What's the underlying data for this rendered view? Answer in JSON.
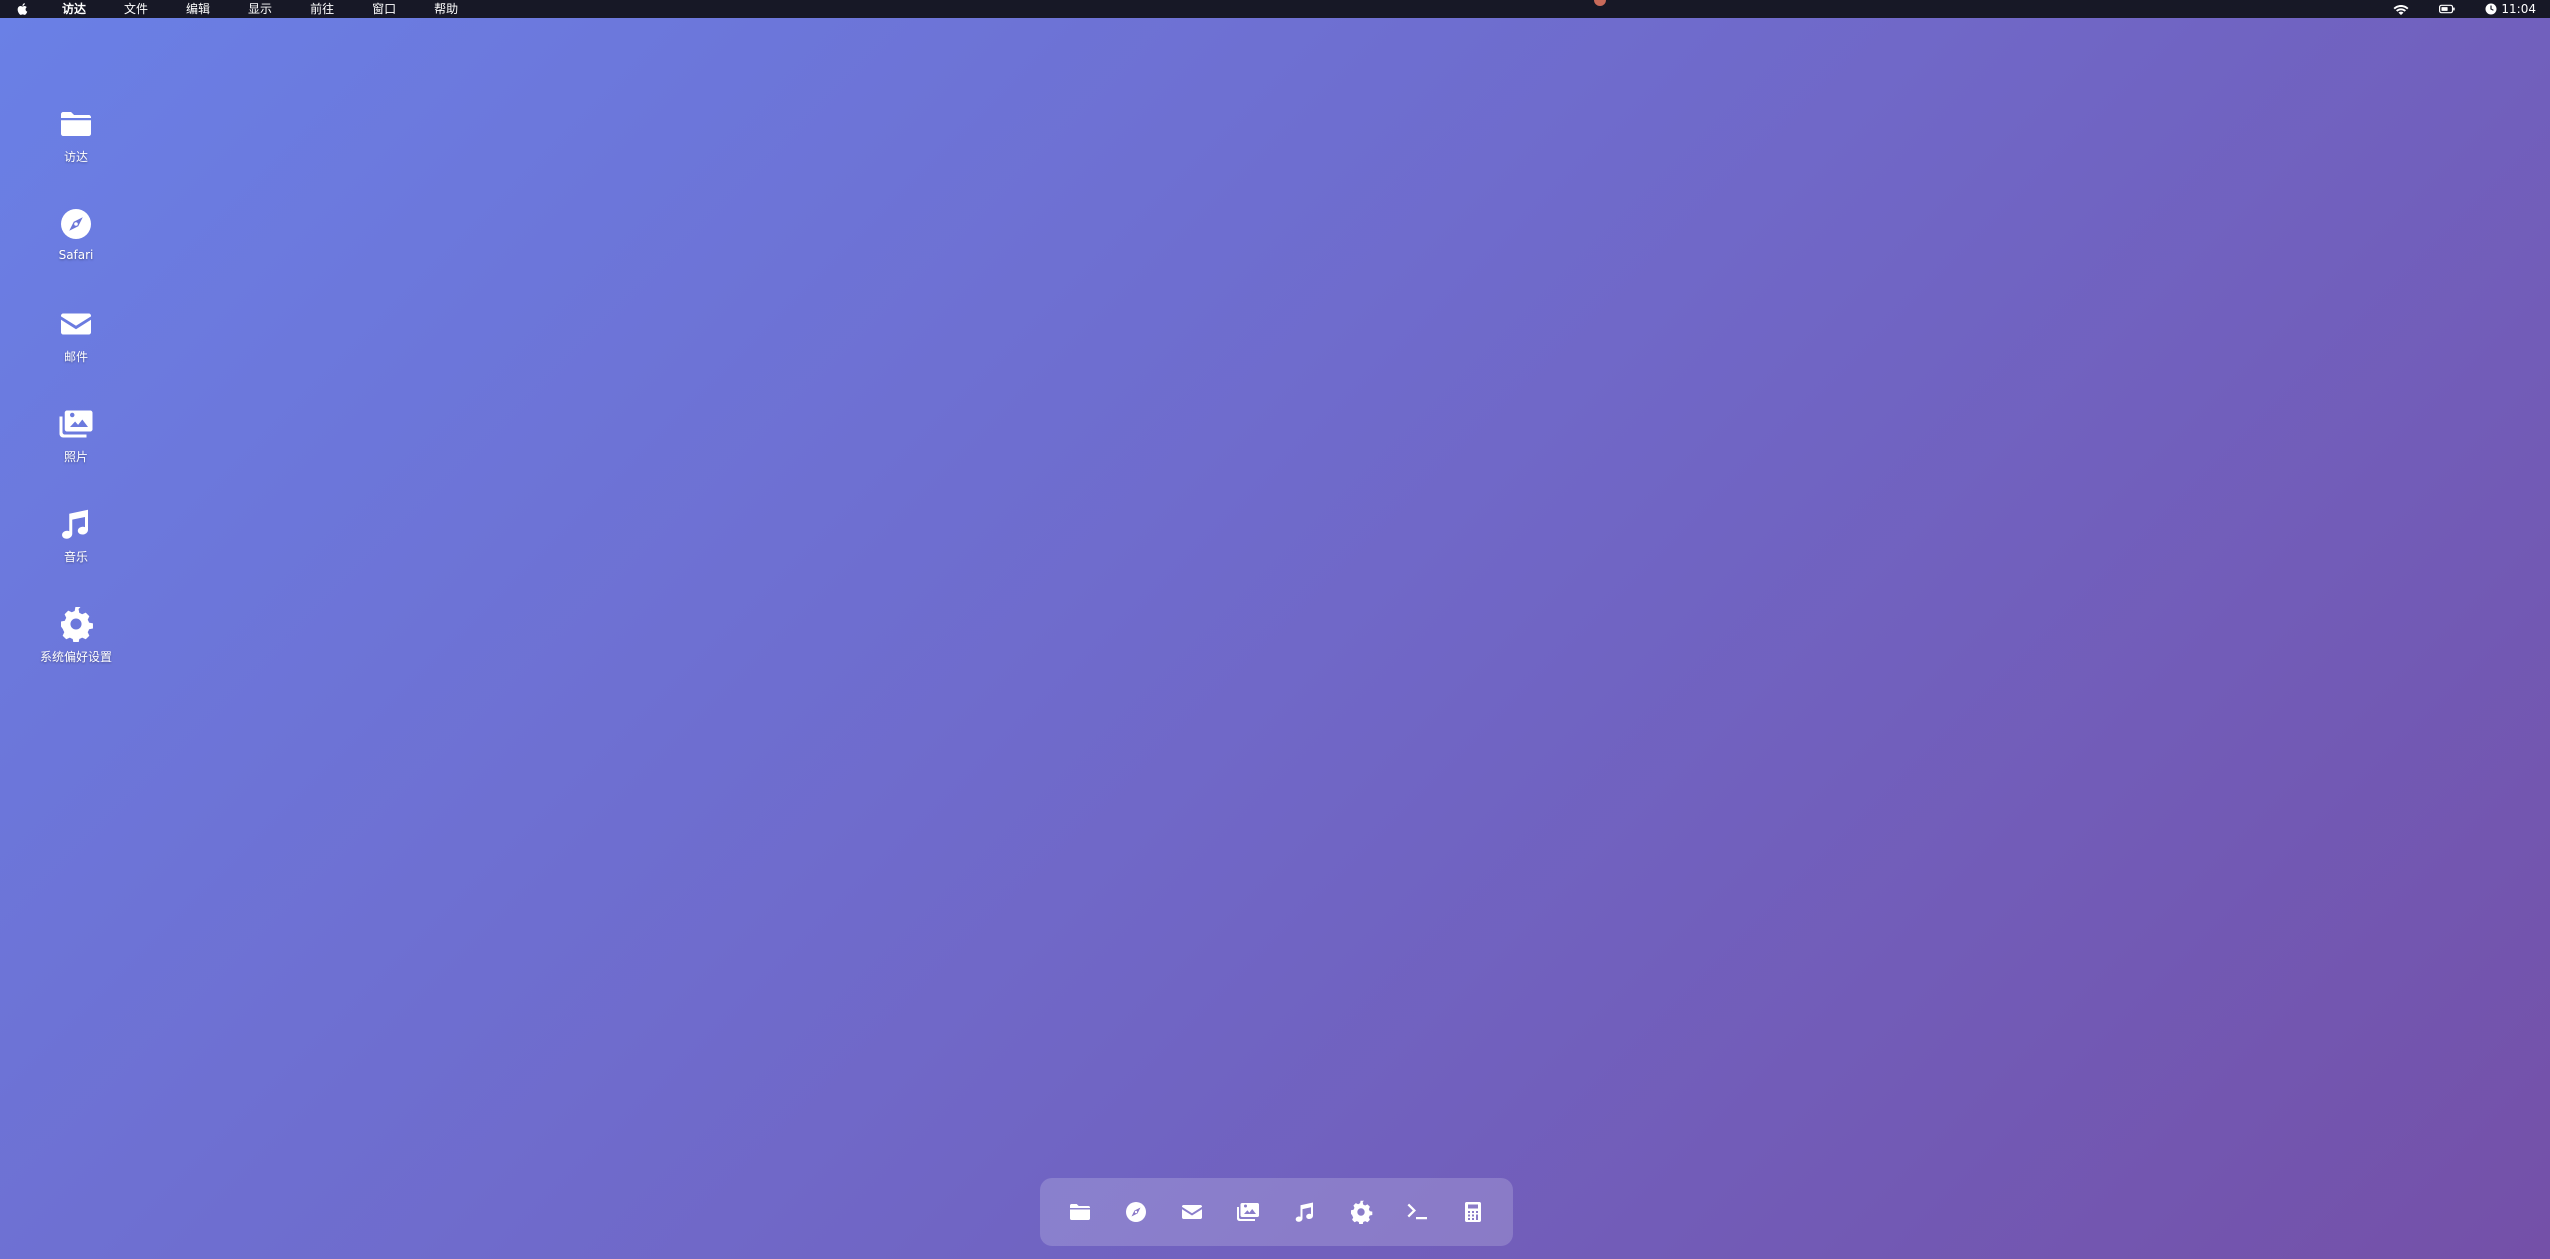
{
  "menubar": {
    "apple_icon": "apple-logo-icon",
    "items": [
      {
        "label": "访达"
      },
      {
        "label": "文件"
      },
      {
        "label": "编辑"
      },
      {
        "label": "显示"
      },
      {
        "label": "前往"
      },
      {
        "label": "窗口"
      },
      {
        "label": "帮助"
      }
    ],
    "status": {
      "wifi_icon": "wifi-icon",
      "battery_icon": "battery-icon",
      "clock_icon": "clock-icon",
      "time": "11:04"
    }
  },
  "desktop": {
    "icons": [
      {
        "label": "访达",
        "icon": "folder-icon"
      },
      {
        "label": "Safari",
        "icon": "compass-icon"
      },
      {
        "label": "邮件",
        "icon": "mail-icon"
      },
      {
        "label": "照片",
        "icon": "photos-icon"
      },
      {
        "label": "音乐",
        "icon": "music-icon"
      },
      {
        "label": "系统偏好设置",
        "icon": "gear-icon"
      }
    ]
  },
  "dock": {
    "items": [
      {
        "name": "finder",
        "icon": "folder-icon"
      },
      {
        "name": "safari",
        "icon": "compass-icon"
      },
      {
        "name": "mail",
        "icon": "mail-icon"
      },
      {
        "name": "photos",
        "icon": "photos-icon"
      },
      {
        "name": "music",
        "icon": "music-icon"
      },
      {
        "name": "system-preferences",
        "icon": "gear-icon"
      },
      {
        "name": "terminal",
        "icon": "terminal-icon"
      },
      {
        "name": "calculator",
        "icon": "calculator-icon"
      }
    ]
  },
  "colors": {
    "wallpaper_start": "#6a80e6",
    "wallpaper_end": "#7450a8",
    "menubar_bg": "#171826"
  }
}
